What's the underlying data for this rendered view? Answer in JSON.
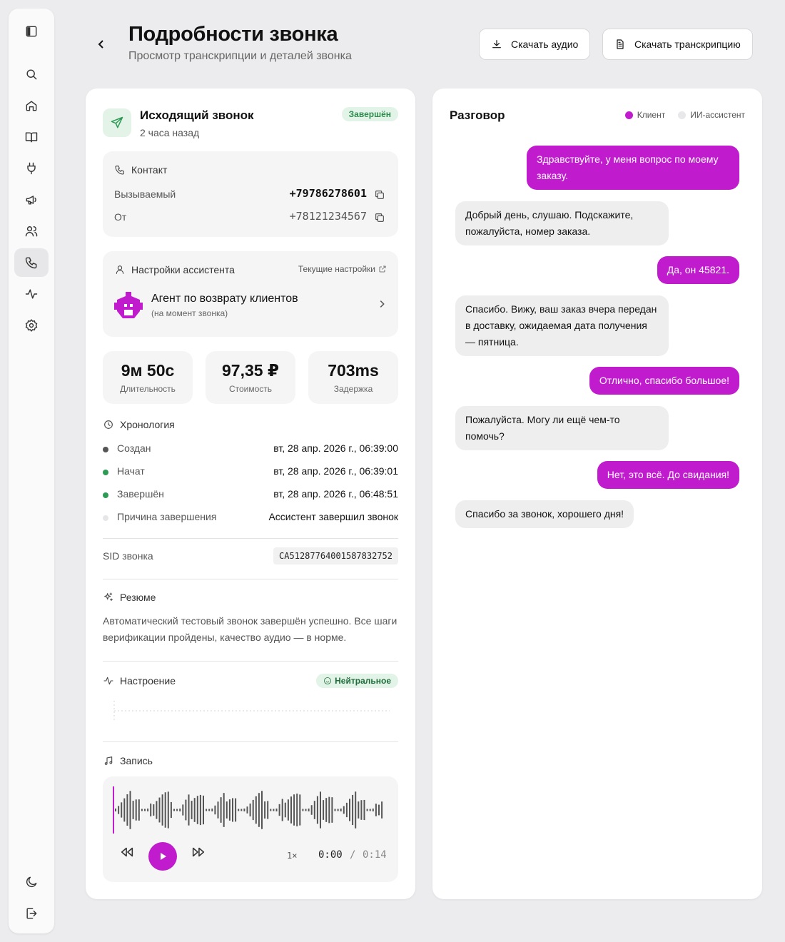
{
  "header": {
    "title": "Подробности звонка",
    "subtitle": "Просмотр транскрипции и деталей звонка",
    "download_audio": "Скачать аудио",
    "download_transcript": "Скачать транскрипцию"
  },
  "call": {
    "type": "Исходящий звонок",
    "time_ago": "2 часа назад",
    "status": "Завершён",
    "status_color": "#2e8b4e"
  },
  "contact": {
    "label": "Контакт",
    "callee_label": "Вызываемый",
    "callee_number": "+79786278601",
    "from_label": "От",
    "from_number": "+78121234567"
  },
  "assistant": {
    "label": "Настройки ассистента",
    "current_settings": "Текущие настройки",
    "agent_name": "Агент по возврату клиентов",
    "agent_note": "(на момент звонка)"
  },
  "stats": [
    {
      "value": "9м 50с",
      "label": "Длительность"
    },
    {
      "value": "97,35 ₽",
      "label": "Стоимость"
    },
    {
      "value": "703ms",
      "label": "Задержка"
    }
  ],
  "timeline": {
    "title": "Хронология",
    "rows": [
      {
        "label": "Создан",
        "value": "вт, 28 апр. 2026 г., 06:39:00",
        "dot": "#555555"
      },
      {
        "label": "Начат",
        "value": "вт, 28 апр. 2026 г., 06:39:01",
        "dot": "#2e9a55"
      },
      {
        "label": "Завершён",
        "value": "вт, 28 апр. 2026 г., 06:48:51",
        "dot": "#2e9a55"
      },
      {
        "label": "Причина завершения",
        "value": "Ассистент завершил звонок",
        "dot": "#e6e6e8"
      }
    ]
  },
  "sid": {
    "label": "SID звонка",
    "value": "CA512877640015878327 52"
  },
  "summary": {
    "title": "Резюме",
    "text": "Автоматический тестовый звонок завершён успешно. Все шаги верификации пройдены, качество аудио — в норме."
  },
  "mood": {
    "title": "Настроение",
    "value": "Нейтральное"
  },
  "recording": {
    "title": "Запись",
    "speed": "1×",
    "current": "0:00",
    "separator": "/",
    "total": "0:14",
    "progress": 0
  },
  "conversation": {
    "title": "Разговор",
    "legend_client": "Клиент",
    "legend_ai": "ИИ-ассистент",
    "client_color": "#c01ccd",
    "messages": [
      {
        "role": "client",
        "text": "Здравствуйте, у меня вопрос по моему заказу."
      },
      {
        "role": "ai",
        "text": "Добрый день, слушаю. Подскажите, пожалуйста, номер заказа."
      },
      {
        "role": "client",
        "text": "Да, он 45821."
      },
      {
        "role": "ai",
        "text": "Спасибо. Вижу, ваш заказ вчера передан в доставку, ожидаемая дата получения — пятница."
      },
      {
        "role": "client",
        "text": "Отлично, спасибо большое!"
      },
      {
        "role": "ai",
        "text": "Пожалуйста. Могу ли ещё чем-то помочь?"
      },
      {
        "role": "client",
        "text": "Нет, это всё. До свидания!"
      },
      {
        "role": "ai",
        "text": "Спасибо за звонок, хорошего дня!"
      }
    ]
  }
}
